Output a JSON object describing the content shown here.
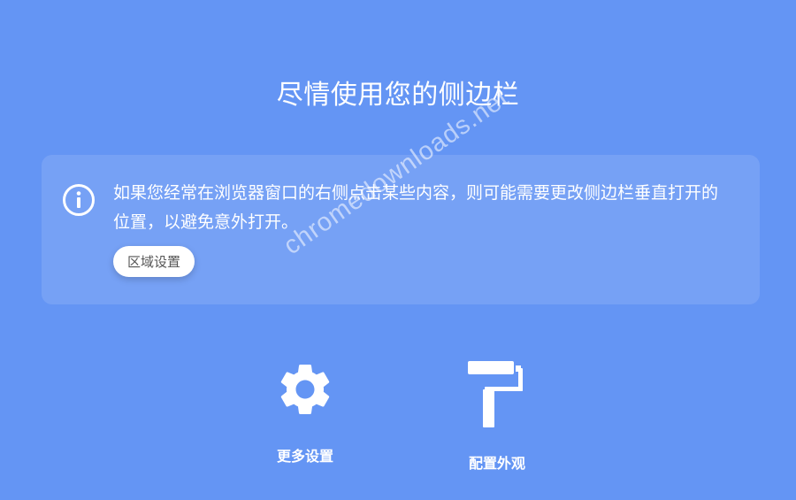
{
  "header": {
    "title": "尽情使用您的侧边栏"
  },
  "info_card": {
    "icon": "info-icon",
    "text": "如果您经常在浏览器窗口的右侧点击某些内容，则可能需要更改侧边栏垂直打开的位置，以避免意外打开。",
    "button_label": "区域设置"
  },
  "watermark": {
    "text": "chromedownloads.net"
  },
  "actions": [
    {
      "label": "更多设置",
      "icon": "gear-icon"
    },
    {
      "label": "配置外观",
      "icon": "paint-roller-icon"
    }
  ],
  "colors": {
    "background": "#6495f4",
    "card": "rgba(255,255,255,0.12)",
    "text": "#ffffff",
    "button_bg": "#ffffff",
    "button_text": "#555555"
  }
}
